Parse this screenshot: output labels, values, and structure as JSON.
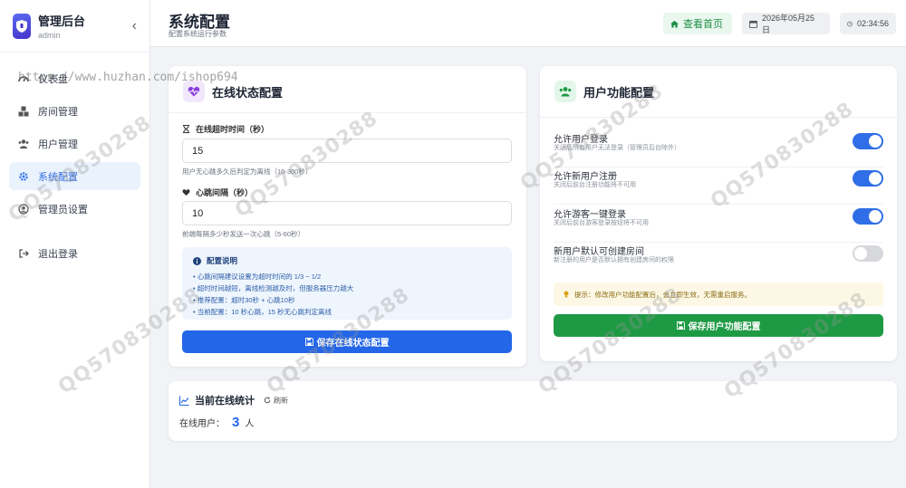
{
  "brand": {
    "title": "管理后台",
    "subtitle": "admin",
    "collapse": "‹"
  },
  "nav": [
    {
      "label": "仪表盘",
      "icon": "dashboard-icon"
    },
    {
      "label": "房间管理",
      "icon": "cubes-icon"
    },
    {
      "label": "用户管理",
      "icon": "users-icon"
    },
    {
      "label": "系统配置",
      "icon": "gear-icon",
      "active": true
    },
    {
      "label": "管理员设置",
      "icon": "user-icon"
    },
    {
      "label": "退出登录",
      "icon": "logout-icon"
    }
  ],
  "header": {
    "title": "系统配置",
    "subtitle": "配置系统运行参数",
    "home_button": "查看首页",
    "date": "2026年05月25日",
    "time": "02:34:56"
  },
  "online_config": {
    "title": "在线状态配置",
    "timeout": {
      "label": "在线超时时间（秒）",
      "value": "15",
      "hint": "用户无心跳多久后判定为离线（10-300秒）"
    },
    "heartbeat": {
      "label": "心跳间隔（秒）",
      "value": "10",
      "hint": "前端每隔多少秒发送一次心跳（5-60秒）"
    },
    "info": {
      "title": "配置说明",
      "lines": [
        "• 心跳间隔建议设置为超时时间的 1/3 ~ 1/2",
        "• 超时时间越短，离线检测越及时，但服务器压力越大",
        "• 推荐配置：超时30秒 + 心跳10秒",
        "• 当前配置：10 秒心跳，15 秒无心跳判定离线"
      ]
    },
    "save_button": "保存在线状态配置"
  },
  "user_config": {
    "title": "用户功能配置",
    "toggles": [
      {
        "title": "允许用户登录",
        "desc": "关闭后所有用户无法登录（管理员后台除外）",
        "on": true
      },
      {
        "title": "允许新用户注册",
        "desc": "关闭后前台注册功能将不可用",
        "on": true
      },
      {
        "title": "允许游客一键登录",
        "desc": "关闭后前台游客登录按钮将不可用",
        "on": true
      },
      {
        "title": "新用户默认可创建房间",
        "desc": "新注册的用户是否默认拥有创建房间的权限",
        "on": false
      }
    ],
    "tip": "提示：修改用户功能配置后，会立即生效，无需重启服务。",
    "save_button": "保存用户功能配置"
  },
  "stats": {
    "title": "当前在线统计",
    "refresh": "刷新",
    "label": "在线用户：",
    "count": "3",
    "unit": "人"
  },
  "watermarks": {
    "url": "https://www.huzhan.com/ishop694",
    "qq": "QQ570830288"
  },
  "colors": {
    "accent": "#2466e8",
    "success": "#1f9a44",
    "active_nav_bg": "#eaf2fd"
  }
}
